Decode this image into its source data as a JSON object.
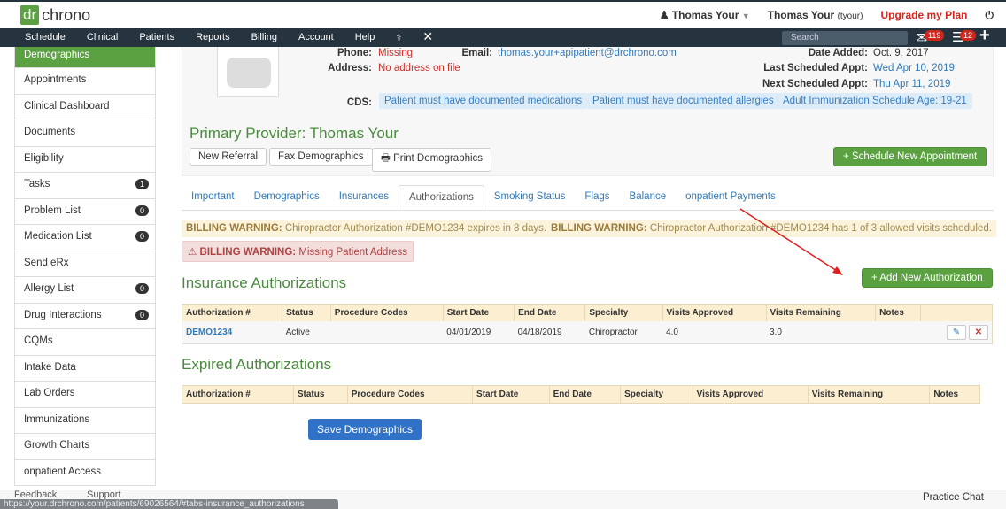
{
  "brand": {
    "logo_a": "dr",
    "logo_b": "chrono",
    "accent": "#5ba142"
  },
  "topbar": {
    "user_menu": "Thomas Your",
    "user_name": "Thomas Your",
    "user_handle": "(tyour)",
    "upgrade": "Upgrade my Plan"
  },
  "nav": {
    "items": [
      "Schedule",
      "Clinical",
      "Patients",
      "Reports",
      "Billing",
      "Account",
      "Help"
    ],
    "search_placeholder": "Search",
    "mail_count": "119",
    "tasks_count": "12"
  },
  "sidebar": {
    "items": [
      {
        "label": "Demographics"
      },
      {
        "label": "Appointments"
      },
      {
        "label": "Clinical Dashboard"
      },
      {
        "label": "Documents"
      },
      {
        "label": "Eligibility"
      },
      {
        "label": "Tasks",
        "count": "1"
      },
      {
        "label": "Problem List",
        "count": "0"
      },
      {
        "label": "Medication List",
        "count": "0"
      },
      {
        "label": "Send eRx"
      },
      {
        "label": "Allergy List",
        "count": "0"
      },
      {
        "label": "Drug Interactions",
        "count": "0"
      },
      {
        "label": "CQMs"
      },
      {
        "label": "Intake Data"
      },
      {
        "label": "Lab Orders"
      },
      {
        "label": "Immunizations"
      },
      {
        "label": "Growth Charts"
      },
      {
        "label": "onpatient Access"
      }
    ]
  },
  "patient": {
    "phone_label": "Phone:",
    "phone": "Missing",
    "email_label": "Email:",
    "email": "thomas.your+apipatient@drchrono.com",
    "address_label": "Address:",
    "address": "No address on file",
    "date_added_label": "Date Added:",
    "date_added": "Oct. 9, 2017",
    "last_appt_label": "Last Scheduled Appt:",
    "last_appt": "Wed Apr 10, 2019",
    "next_appt_label": "Next Scheduled Appt:",
    "next_appt": "Thu Apr 11, 2019",
    "cds_label": "CDS:",
    "cds": [
      "Patient must have documented medications",
      "Patient must have documented allergies",
      "Adult Immunization Schedule Age: 19-21"
    ],
    "primary_provider": "Primary Provider: Thomas Your"
  },
  "actions": {
    "new_referral": "New Referral",
    "fax": "Fax Demographics",
    "print": "Print Demographics",
    "schedule": "+ Schedule New Appointment"
  },
  "tabs": [
    {
      "label": "Important"
    },
    {
      "label": "Demographics"
    },
    {
      "label": "Insurances"
    },
    {
      "label": "Authorizations",
      "active": true
    },
    {
      "label": "Smoking Status"
    },
    {
      "label": "Flags"
    },
    {
      "label": "Balance"
    },
    {
      "label": "onpatient Payments"
    }
  ],
  "warnings": {
    "prefix": "BILLING WARNING:",
    "w1": "Chiropractor Authorization #DEMO1234 expires in 8 days.",
    "w2": "Chiropractor Authorization #DEMO1234 has 1 of 3 allowed visits scheduled.",
    "w3": "Missing Patient Address"
  },
  "insurance_auth": {
    "title": "Insurance Authorizations",
    "add_button": "+ Add New Authorization",
    "columns": [
      "Authorization #",
      "Status",
      "Procedure Codes",
      "Start Date",
      "End Date",
      "Specialty",
      "Visits Approved",
      "Visits Remaining",
      "Notes",
      ""
    ],
    "rows": [
      [
        "DEMO1234",
        "Active",
        "",
        "04/01/2019",
        "04/18/2019",
        "Chiropractor",
        "4.0",
        "3.0",
        ""
      ]
    ]
  },
  "expired_auth": {
    "title": "Expired Authorizations",
    "columns": [
      "Authorization #",
      "Status",
      "Procedure Codes",
      "Start Date",
      "End Date",
      "Specialty",
      "Visits Approved",
      "Visits Remaining",
      "Notes"
    ]
  },
  "save_button": "Save Demographics",
  "footer": {
    "feedback": "Feedback",
    "support": "Support",
    "url": "https://your.drchrono.com/patients/69026564/#tabs-insurance_authorizations",
    "chat": "Practice Chat"
  }
}
